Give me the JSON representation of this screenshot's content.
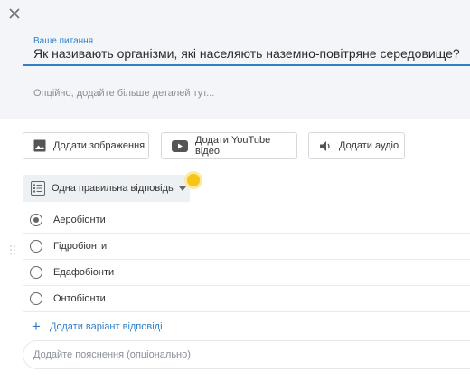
{
  "question": {
    "label": "Ваше питання",
    "value": "Як називають організми, які населяють наземно-повітряне середовище?",
    "details_placeholder": "Опційно, додайте більше деталей тут..."
  },
  "media_buttons": [
    {
      "label": "Додати зображення",
      "icon": "image-icon"
    },
    {
      "label": "Додати YouTube відео",
      "icon": "youtube-icon"
    },
    {
      "label": "Додати аудіо",
      "icon": "speaker-icon"
    }
  ],
  "answer_type": {
    "label": "Одна правильна відповідь",
    "icon": "list-icon"
  },
  "answers": [
    {
      "label": "Аеробіонти",
      "selected": true
    },
    {
      "label": "Гідробіонти",
      "selected": false
    },
    {
      "label": "Едафобіонти",
      "selected": false
    },
    {
      "label": "Онтобіонти",
      "selected": false
    }
  ],
  "add_answer_label": "Додати варіант відповіді",
  "explanation_placeholder": "Додайте пояснення (опціонально)",
  "colors": {
    "accent": "#2f80c8",
    "panel": "#f3f5f9",
    "highlight": "#f5c518"
  }
}
